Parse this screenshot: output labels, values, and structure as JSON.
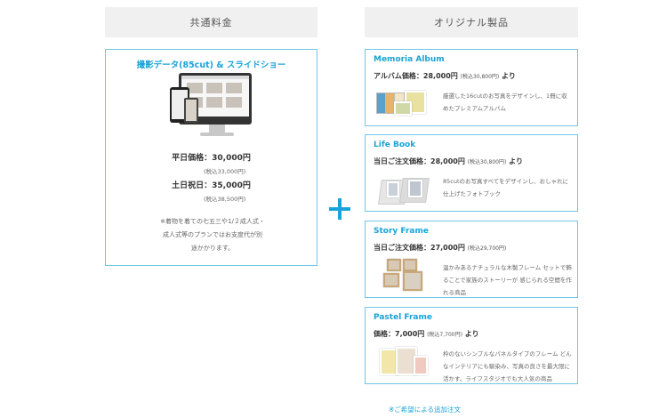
{
  "headers": {
    "left": "共通料金",
    "right": "オリジナル製品"
  },
  "common": {
    "title": "撮影データ(85cut) & スライドショー",
    "weekday_price": "平日価格：30,000円",
    "weekday_tax": "(税込33,000円)",
    "holiday_price": "土日祝日：35,000円",
    "holiday_tax": "(税込38,500円)",
    "note_lines": [
      "※着物を着ての七五三や1/２成人式・",
      "成人式等のプランではお支度代が別",
      "途かかります。"
    ]
  },
  "products": [
    {
      "title": "Memoria Album",
      "price": "アルバム価格：28,000円 ",
      "tax": "(税込30,800円)",
      "suffix": " より",
      "desc": "厳選した16cutのお写真をデザインし、1冊に収めたプレミアムアルバム",
      "icon": "album-image"
    },
    {
      "title": "Life Book",
      "price": "当日ご注文価格：28,000円 ",
      "tax": "(税込30,800円)",
      "suffix": " より",
      "desc": "85cutのお写真すべてをデザインし、おしゃれに仕上げたフォトブック",
      "icon": "photobook-image"
    },
    {
      "title": "Story Frame",
      "price": "当日ご注文価格：27,000円 ",
      "tax": "(税込29,700円)",
      "suffix": "",
      "desc": "温かみあるナチュラルな木製フレーム セットで飾ることで家族のストーリーが 感じられる空間を作れる商品",
      "icon": "frame-image"
    },
    {
      "title": "Pastel Frame",
      "price": "価格：7,000円 ",
      "tax": "(税込7,700円)",
      "suffix": " より",
      "desc": "枠のないシンプルなパネルタイプのフレーム どんなインテリアにも馴染み、写真の良さを最大限に活かす。ライフスタジオでも大人気の商品",
      "icon": "panel-image"
    }
  ],
  "footer_note": "※ご希望による追加注文",
  "colors": {
    "accent": "#1aa3d8",
    "border": "#6ec6e6",
    "header_bg": "#f0f0f0"
  }
}
